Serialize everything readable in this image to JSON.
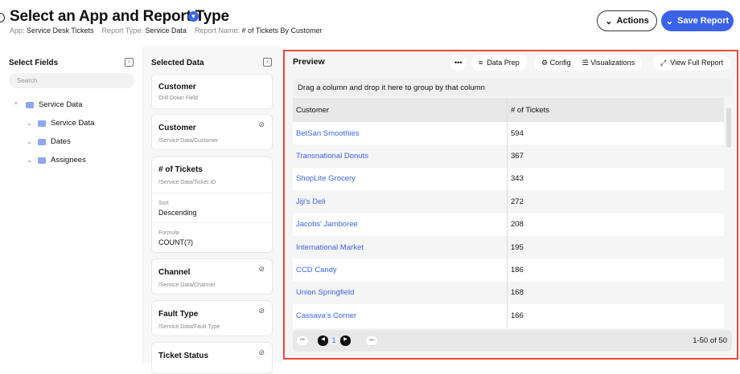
{
  "header": {
    "title": "Select an App and Report Type",
    "meta": [
      {
        "label": "App:",
        "value": "Service Desk Tickets"
      },
      {
        "label": "Report Type:",
        "value": "Service Data"
      },
      {
        "label": "Report Name:",
        "value": "# of Tickets By Customer"
      }
    ],
    "actions_label": "Actions",
    "save_label": "Save Report"
  },
  "select_fields": {
    "title": "Select Fields",
    "search_placeholder": "Search",
    "tree": [
      "Service Data",
      "Service Data",
      "Dates",
      "Assignees"
    ]
  },
  "selected_data": {
    "title": "Selected Data",
    "cards": [
      {
        "title": "Customer",
        "sub": "Drill Down Field"
      },
      {
        "title": "Customer",
        "sub": "/Service Data/Customer"
      },
      {
        "title": "# of Tickets",
        "sub": "/Service Data/Ticket ID",
        "sort_label": "Sort",
        "sort": "Descending",
        "formula_label": "Formula",
        "formula": "COUNT(?)"
      },
      {
        "title": "Channel",
        "sub": "/Service Data/Channel"
      },
      {
        "title": "Fault Type",
        "sub": "/Service Data/Fault Type"
      },
      {
        "title": "Ticket Status"
      }
    ]
  },
  "preview": {
    "title": "Preview",
    "more": "•••",
    "data_prep": "Data Prep",
    "config": "Config",
    "visualizations": "Visualizations",
    "view_full": "View Full Report",
    "group_hint": "Drag a column and drop it here to group by that column",
    "columns": [
      "Customer",
      "# of Tickets"
    ],
    "rows": [
      [
        "BetSan Smoothies",
        "594"
      ],
      [
        "Transnational Donuts",
        "367"
      ],
      [
        "ShopLite Grocery",
        "343"
      ],
      [
        "Jiji's Deli",
        "272"
      ],
      [
        "Jacobs' Jamboree",
        "208"
      ],
      [
        "International Market",
        "195"
      ],
      [
        "CCD Candy",
        "186"
      ],
      [
        "Union Springfield",
        "168"
      ],
      [
        "Cassava's Corner",
        "166"
      ]
    ],
    "page": "1",
    "range": "1-50 of 50"
  }
}
